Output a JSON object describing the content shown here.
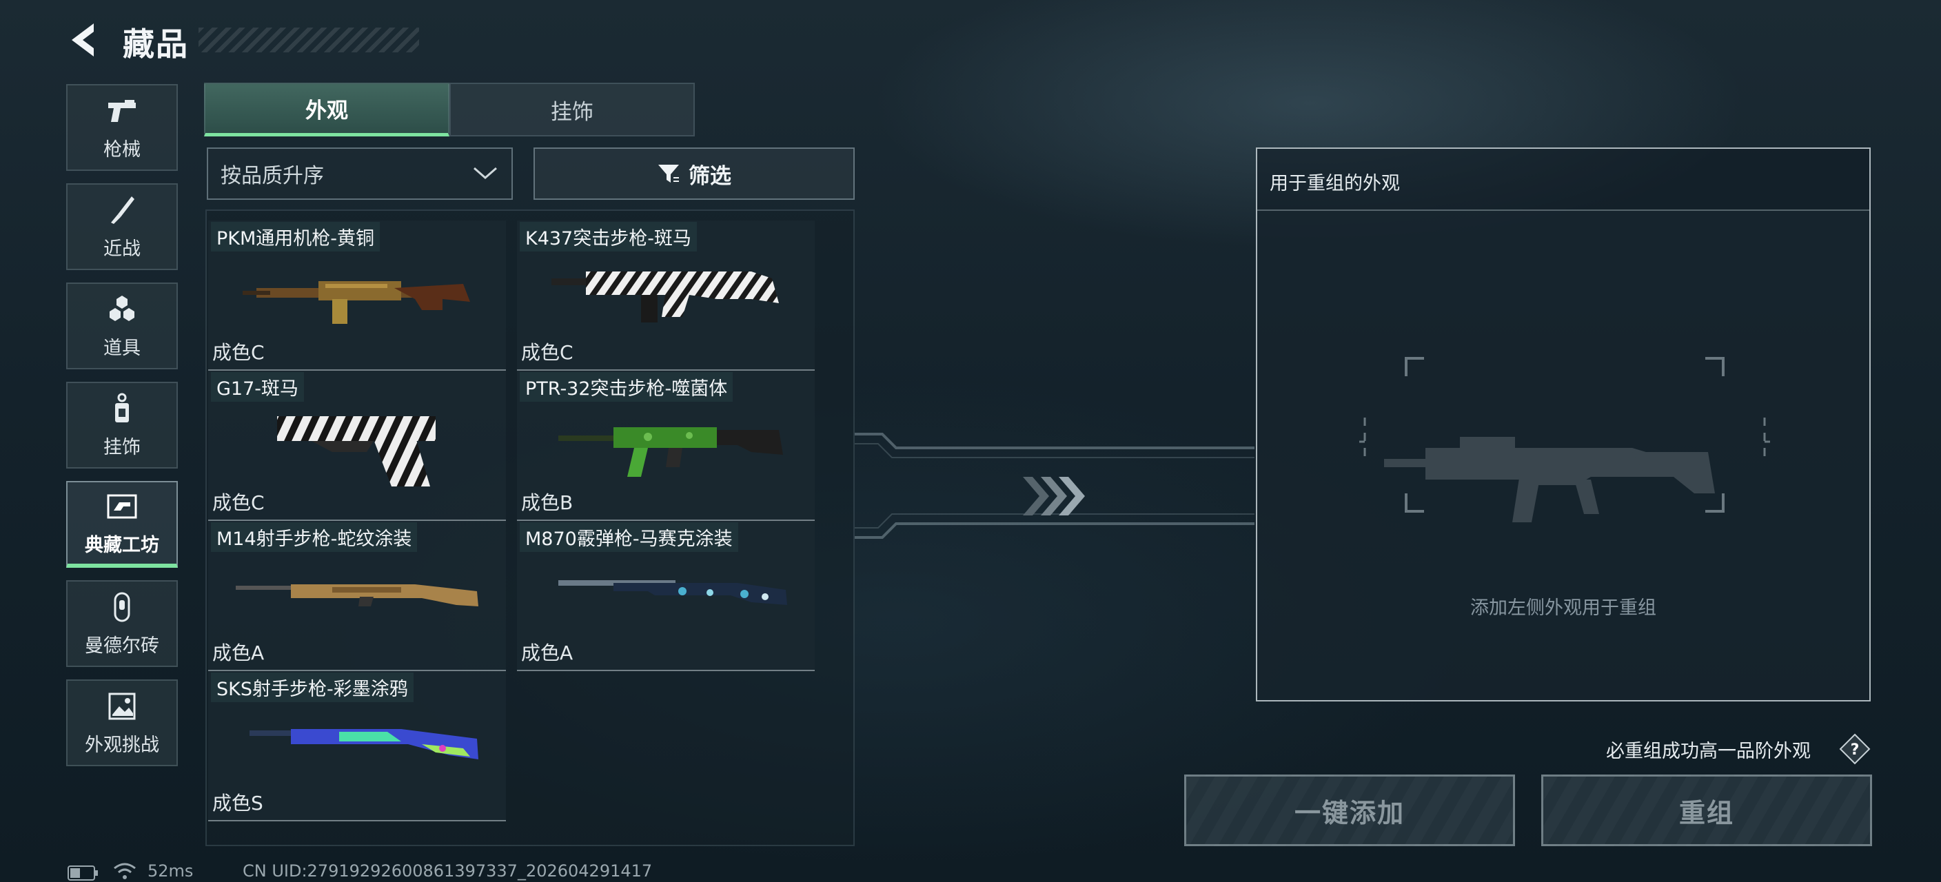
{
  "header": {
    "title": "藏品"
  },
  "sidebar": {
    "items": [
      {
        "label": "枪械",
        "icon": "pistol-icon"
      },
      {
        "label": "近战",
        "icon": "knife-icon"
      },
      {
        "label": "道具",
        "icon": "grenades-icon"
      },
      {
        "label": "挂饰",
        "icon": "charm-icon"
      },
      {
        "label": "典藏工坊",
        "icon": "workshop-icon",
        "active": true
      },
      {
        "label": "曼德尔砖",
        "icon": "mandel-brick-icon"
      },
      {
        "label": "外观挑战",
        "icon": "challenge-icon"
      }
    ]
  },
  "tabs": [
    {
      "label": "外观",
      "active": true
    },
    {
      "label": "挂饰",
      "active": false
    }
  ],
  "sort": {
    "value": "按品质升序"
  },
  "filter": {
    "label": "筛选"
  },
  "items": [
    {
      "name": "PKM通用机枪-黄铜",
      "grade": "成色C"
    },
    {
      "name": "K437突击步枪-斑马",
      "grade": "成色C"
    },
    {
      "name": "G17-斑马",
      "grade": "成色C"
    },
    {
      "name": "PTR-32突击步枪-噬菌体",
      "grade": "成色B"
    },
    {
      "name": "M14射手步枪-蛇纹涂装",
      "grade": "成色A"
    },
    {
      "name": "M870霰弹枪-马赛克涂装",
      "grade": "成色A"
    },
    {
      "name": "SKS射手步枪-彩墨涂鸦",
      "grade": "成色S"
    }
  ],
  "panel": {
    "title": "用于重组的外观",
    "empty_hint": "添加左侧外观用于重组"
  },
  "guarantee_text": "必重组成功高一品阶外观",
  "buttons": {
    "add_all": "一键添加",
    "recombine": "重组"
  },
  "status": {
    "latency": "52ms",
    "uid": "CN UID:27919292600861397337_202604291417"
  },
  "colors": {
    "accent": "#7ee3a0",
    "background": "#14222b"
  }
}
